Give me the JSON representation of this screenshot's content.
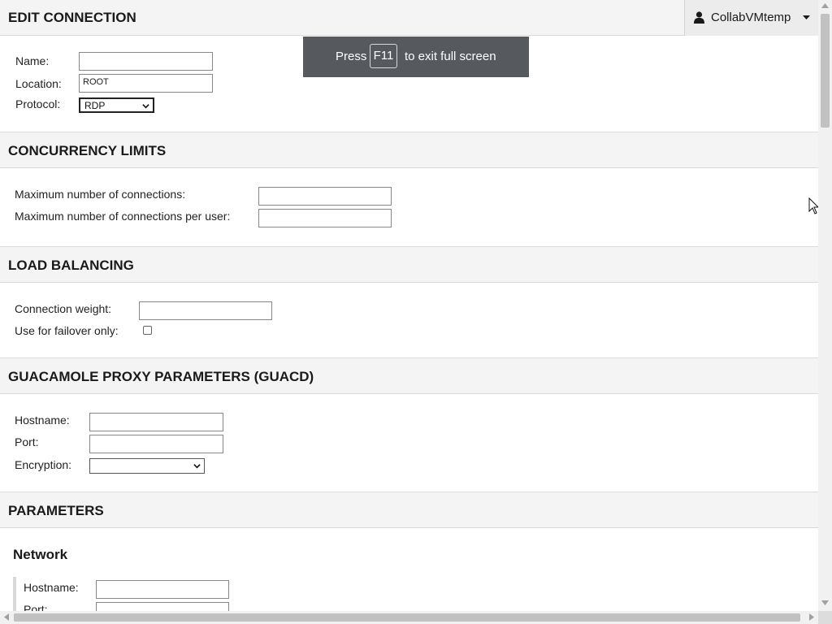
{
  "sections": {
    "edit_connection": "EDIT CONNECTION",
    "concurrency": "CONCURRENCY LIMITS",
    "load_balancing": "LOAD BALANCING",
    "proxy": "GUACAMOLE PROXY PARAMETERS (GUACD)",
    "parameters": "PARAMETERS"
  },
  "user_menu": {
    "username": "CollabVMtemp",
    "icon": "user-icon"
  },
  "fullscreen_toast": {
    "press": "Press",
    "key": "F11",
    "suffix": "to exit full screen"
  },
  "edit_connection": {
    "name_label": "Name:",
    "name_value": "",
    "location_label": "Location:",
    "location_value": "ROOT",
    "protocol_label": "Protocol:",
    "protocol_value": "RDP"
  },
  "concurrency": {
    "max_connections_label": "Maximum number of connections:",
    "max_connections_value": "",
    "max_per_user_label": "Maximum number of connections per user:",
    "max_per_user_value": ""
  },
  "load_balancing": {
    "weight_label": "Connection weight:",
    "weight_value": "",
    "failover_label": "Use for failover only:",
    "failover_checked": false
  },
  "proxy": {
    "hostname_label": "Hostname:",
    "hostname_value": "",
    "port_label": "Port:",
    "port_value": "",
    "encryption_label": "Encryption:",
    "encryption_value": ""
  },
  "parameters": {
    "network_heading": "Network",
    "hostname_label": "Hostname:",
    "hostname_value": "",
    "port_label": "Port:"
  },
  "colors": {
    "header_bg": "#f4f4f4",
    "toast_bg": "#56595e",
    "user_menu_bg": "#ececec"
  }
}
